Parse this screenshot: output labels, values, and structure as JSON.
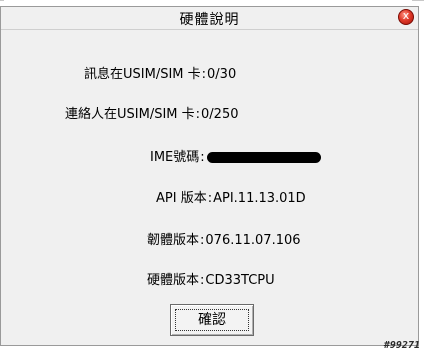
{
  "dialog": {
    "title": "硬體說明",
    "close_label": "x"
  },
  "info": {
    "sms": {
      "label": "訊息在USIM/SIM 卡",
      "value": "0/30"
    },
    "contacts": {
      "label": "連絡人在USIM/SIM 卡",
      "value": "0/250"
    },
    "imei": {
      "label": "IME號碼",
      "value_redacted": true
    },
    "api": {
      "label": "API 版本",
      "value": "API.11.13.01D"
    },
    "firmware": {
      "label": "韌體版本",
      "value": "076.11.07.106"
    },
    "hardware": {
      "label": "硬體版本",
      "value": "CD33TCPU"
    }
  },
  "buttons": {
    "ok_label": "確認"
  },
  "watermark": "#99271"
}
